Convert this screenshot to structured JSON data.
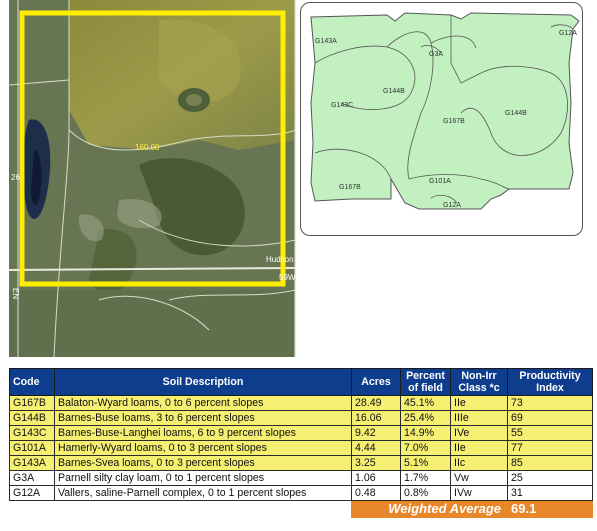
{
  "aerial": {
    "field_label": "160.00",
    "corner_label": "Hudson",
    "edge_labels": [
      "EN",
      "26",
      "59W"
    ],
    "colors": {
      "highlight": "#ffee00"
    }
  },
  "soil_map": {
    "labels": [
      "G143A",
      "G3A",
      "G12A",
      "G144B",
      "G143C",
      "G167B",
      "G144B",
      "G167B",
      "G101A",
      "G12A"
    ],
    "colors": {
      "fill": "#c3f0c0",
      "line": "#555555"
    }
  },
  "table": {
    "headers": {
      "code": "Code",
      "description": "Soil Description",
      "acres": "Acres",
      "percent_l1": "Percent",
      "percent_l2": "of field",
      "class_l1": "Non-Irr",
      "class_l2": "Class *c",
      "index_l1": "Productivity",
      "index_l2": "Index"
    },
    "rows": [
      {
        "code": "G167B",
        "description": "Balaton-Wyard loams, 0 to 6 percent slopes",
        "acres": "28.49",
        "percent": "45.1%",
        "class": "IIe",
        "index": "73"
      },
      {
        "code": "G144B",
        "description": "Barnes-Buse loams, 3 to 6 percent slopes",
        "acres": "16.06",
        "percent": "25.4%",
        "class": "IIIe",
        "index": "69"
      },
      {
        "code": "G143C",
        "description": "Barnes-Buse-Langhei loams, 6 to 9 percent slopes",
        "acres": "9.42",
        "percent": "14.9%",
        "class": "IVe",
        "index": "55"
      },
      {
        "code": "G101A",
        "description": "Hamerly-Wyard loams, 0 to 3 percent slopes",
        "acres": "4.44",
        "percent": "7.0%",
        "class": "IIe",
        "index": "77"
      },
      {
        "code": "G143A",
        "description": "Barnes-Svea loams, 0 to 3 percent slopes",
        "acres": "3.25",
        "percent": "5.1%",
        "class": "IIc",
        "index": "85"
      },
      {
        "code": "G3A",
        "description": "Parnell silty clay loam, 0 to 1 percent slopes",
        "acres": "1.06",
        "percent": "1.7%",
        "class": "Vw",
        "index": "25"
      },
      {
        "code": "G12A",
        "description": "Vallers, saline-Parnell complex, 0 to 1 percent slopes",
        "acres": "0.48",
        "percent": "0.8%",
        "class": "IVw",
        "index": "31"
      }
    ],
    "weighted_average_label": "Weighted Average",
    "weighted_average_value": "69.1",
    "colors": {
      "header": "#0d3d8c",
      "highlight_row": "#f5ef72",
      "total": "#e8862a"
    }
  }
}
